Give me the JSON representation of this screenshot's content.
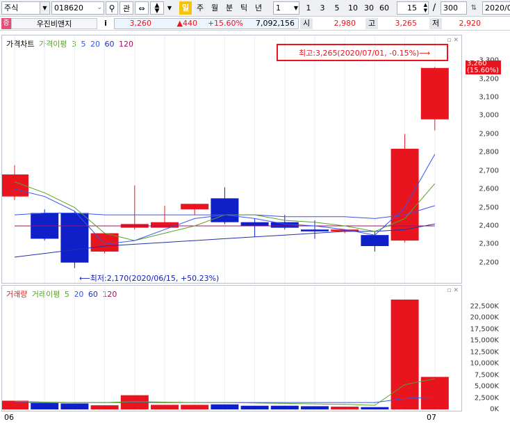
{
  "toolbar": {
    "market": "주식",
    "code": "018620",
    "search_icon": "search-icon",
    "btn_interest": "관",
    "btn_day": "일",
    "periods": [
      "주",
      "월",
      "분",
      "틱",
      "년"
    ],
    "period_value": "1",
    "quick_values": [
      "1",
      "3",
      "5",
      "10",
      "30",
      "60"
    ],
    "count_value": "15",
    "slash": "/",
    "total_value": "300",
    "date_value": "2020/0"
  },
  "info": {
    "badge": "증",
    "name": "우진비앤지",
    "info_btn": "i",
    "price": "3,260",
    "change": "▲440",
    "change_pct": "+15.60%",
    "volume": "7,092,156",
    "open_label": "시",
    "open": "2,980",
    "high_label": "고",
    "high": "3,265",
    "low_label": "저",
    "low": "2,920"
  },
  "price_legend": {
    "title": "가격차트",
    "ma_title": "가격이평",
    "ma_periods": [
      "3",
      "5",
      "20",
      "60",
      "120"
    ]
  },
  "volume_legend": {
    "title": "거래량",
    "ma_title": "거래이평",
    "ma_periods": [
      "5",
      "20",
      "60",
      "120"
    ]
  },
  "annotations": {
    "high": "최고:3,265(2020/07/01, -0.15%)⟶",
    "low": "⟵최저:2,170(2020/06/15, +50.23%)"
  },
  "price_tag": {
    "price": "3,260",
    "pct": "(15.60%)"
  },
  "colors": {
    "up": "#e8151e",
    "down": "#1020c8",
    "ma3": "#111111",
    "ma5": "#5aa02c",
    "ma20": "#3355ee",
    "ma60": "#2030b0",
    "ma120": "#a01060"
  },
  "x_labels": [
    "06",
    "07"
  ],
  "chart_data": {
    "type": "candlestick",
    "price_ylim": [
      2150,
      3350
    ],
    "price_ticks": [
      "3,300",
      "3,200",
      "3,100",
      "3,000",
      "2,900",
      "2,800",
      "2,700",
      "2,600",
      "2,500",
      "2,400",
      "2,300",
      "2,200"
    ],
    "candles": [
      {
        "o": 2560,
        "h": 2730,
        "l": 2540,
        "c": 2680
      },
      {
        "o": 2470,
        "h": 2490,
        "l": 2320,
        "c": 2330
      },
      {
        "o": 2470,
        "h": 2480,
        "l": 2170,
        "c": 2200
      },
      {
        "o": 2260,
        "h": 2280,
        "l": 2250,
        "c": 2360
      },
      {
        "o": 2390,
        "h": 2620,
        "l": 2380,
        "c": 2410
      },
      {
        "o": 2390,
        "h": 2510,
        "l": 2390,
        "c": 2420
      },
      {
        "o": 2490,
        "h": 2520,
        "l": 2460,
        "c": 2520
      },
      {
        "o": 2550,
        "h": 2610,
        "l": 2410,
        "c": 2420
      },
      {
        "o": 2420,
        "h": 2440,
        "l": 2340,
        "c": 2400
      },
      {
        "o": 2420,
        "h": 2460,
        "l": 2380,
        "c": 2390
      },
      {
        "o": 2380,
        "h": 2430,
        "l": 2330,
        "c": 2370
      },
      {
        "o": 2370,
        "h": 2380,
        "l": 2360,
        "c": 2380
      },
      {
        "o": 2350,
        "h": 2370,
        "l": 2260,
        "c": 2290
      },
      {
        "o": 2320,
        "h": 2900,
        "l": 2310,
        "c": 2820
      },
      {
        "o": 2980,
        "h": 3265,
        "l": 2920,
        "c": 3260
      }
    ],
    "ma3": [
      2600,
      2560,
      2480,
      2300,
      2320,
      2380,
      2440,
      2460,
      2440,
      2410,
      2400,
      2380,
      2350,
      2500,
      2790
    ],
    "ma5": [
      2640,
      2580,
      2500,
      2360,
      2320,
      2360,
      2400,
      2460,
      2460,
      2430,
      2420,
      2400,
      2370,
      2440,
      2630
    ],
    "ma20": [
      2460,
      2470,
      2470,
      2460,
      2460,
      2460,
      2460,
      2460,
      2460,
      2450,
      2450,
      2450,
      2440,
      2460,
      2510
    ],
    "ma60": [
      2230,
      2250,
      2270,
      2290,
      2300,
      2310,
      2320,
      2330,
      2340,
      2350,
      2360,
      2370,
      2370,
      2380,
      2410
    ],
    "ma120": [
      2400,
      2400,
      2400,
      2400,
      2400,
      2400,
      2400,
      2400,
      2400,
      2400,
      2400,
      2400,
      2400,
      2400,
      2400
    ],
    "volume_ylim": [
      0,
      24000
    ],
    "volume_ticks": [
      "22,500K",
      "20,000K",
      "17,500K",
      "15,000K",
      "12,500K",
      "10,000K",
      "7,500K",
      "5,000K",
      "2,500K",
      "0K"
    ],
    "volume": [
      1900,
      1400,
      1300,
      900,
      3100,
      1000,
      1000,
      1100,
      800,
      800,
      700,
      600,
      500,
      24500,
      7100
    ],
    "vol_ma5": [
      1800,
      1600,
      1500,
      1500,
      1700,
      1600,
      1500,
      1500,
      1400,
      1300,
      1200,
      1100,
      900,
      5400,
      6700
    ],
    "vol_ma20": [
      1500,
      1500,
      1500,
      1500,
      1500,
      1500,
      1500,
      1500,
      1500,
      1500,
      1500,
      1500,
      1500,
      2400,
      2700
    ]
  }
}
